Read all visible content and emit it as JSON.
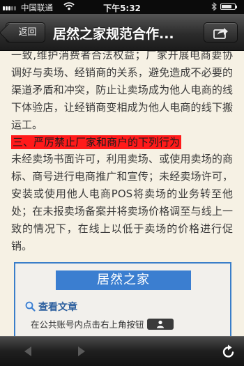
{
  "status_bar": {
    "carrier": "中国联通",
    "time": "下午5:32",
    "battery_level": 0.8
  },
  "nav": {
    "back_label": "返回",
    "title": "居然之家规范合作..."
  },
  "article": {
    "paragraph_1": "一致,维护消费者合法权益；厂家开展电商要协调好与卖场、经销商的关系，避免造成不必要的渠道矛盾和冲突，防止让卖场成为他人电商的线下体验店，让经销商变相成为他人电商的线下搬运工。",
    "heading": "三、严厉禁止厂家和商户的下列行为",
    "paragraph_2": "未经卖场书面许可，利用卖场、或使用卖场的商标、商号进行电商推广和宣传；未经卖场许可，安装或使用他人电商POS将卖场的业务转至他处；在未报卖场备案并将卖场价格调至与线上一致的情况下，在线上以低于卖场的价格进行促销。"
  },
  "card": {
    "banner": "居然之家",
    "link": "查看文章",
    "hint": "在公共账号内点击右上角按钮"
  },
  "icons": {
    "back": "back-arrow-icon",
    "forward": "forward-arrow-icon",
    "refresh": "refresh-icon",
    "share": "share-icon",
    "search": "search-icon",
    "person": "person-icon"
  },
  "colors": {
    "page_bg": "#f6f1e4",
    "heading_highlight": "#ff1a1a",
    "card_border": "#3a7ec9",
    "banner": "#3b7ed0",
    "link": "#2c5f9e"
  }
}
